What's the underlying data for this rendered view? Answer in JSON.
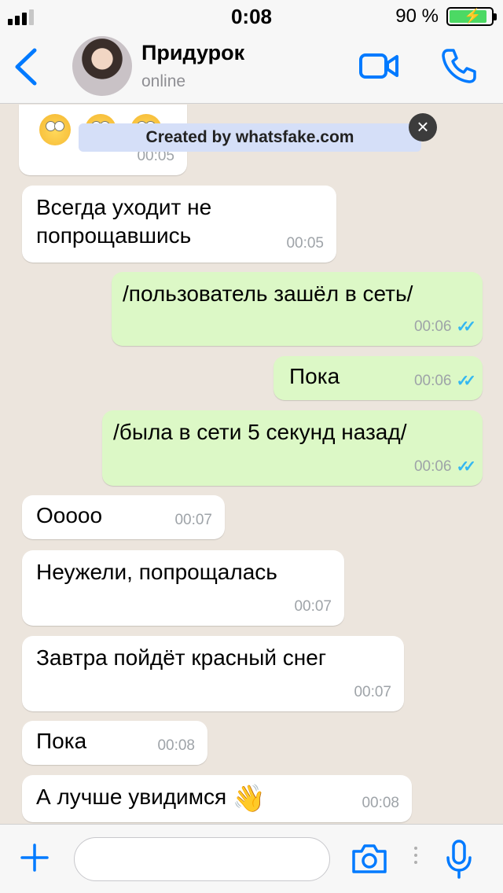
{
  "status_bar": {
    "time": "0:08",
    "battery": "90 %",
    "battery_level": 0.9
  },
  "header": {
    "contact_name": "Придурок",
    "contact_status": "online",
    "icons": [
      "back-chevron-icon",
      "video-call-icon",
      "phone-icon"
    ]
  },
  "watermark": {
    "text": "Created by whatsfake.com",
    "close": "×"
  },
  "messages": [
    {
      "dir": "in",
      "emoji": "face-with-rolling-eyes",
      "count": 3,
      "time": "00:05"
    },
    {
      "dir": "in",
      "lines": [
        "Всегда уходит не",
        "попрощавшись"
      ],
      "time": "00:05"
    },
    {
      "dir": "out",
      "text": "/пользователь зашёл в сеть/",
      "time": "00:06",
      "read": true
    },
    {
      "dir": "out",
      "text": "Пока",
      "time": "00:06",
      "read": true
    },
    {
      "dir": "out",
      "text": "/была в сети 5 секунд назад/",
      "time": "00:06",
      "read": true
    },
    {
      "dir": "in",
      "text": "Ооооо",
      "time": "00:07"
    },
    {
      "dir": "in",
      "text": "Неужели, попрощалась",
      "time": "00:07"
    },
    {
      "dir": "in",
      "text": "Завтра пойдёт красный снег",
      "time": "00:07"
    },
    {
      "dir": "in",
      "text": "Пока",
      "time": "00:08"
    },
    {
      "dir": "in",
      "text": "А лучше увидимся",
      "emoji": "waving-hand",
      "time": "00:08"
    }
  ],
  "input_bar": {
    "placeholder": "",
    "icons": [
      "plus-icon",
      "camera-icon",
      "microphone-icon"
    ]
  },
  "colors": {
    "incoming": "#ffffff",
    "outgoing": "#dcf8c6",
    "accent": "#007aff",
    "read_ticks": "#34b7f1",
    "chat_bg": "#ece5dd"
  }
}
